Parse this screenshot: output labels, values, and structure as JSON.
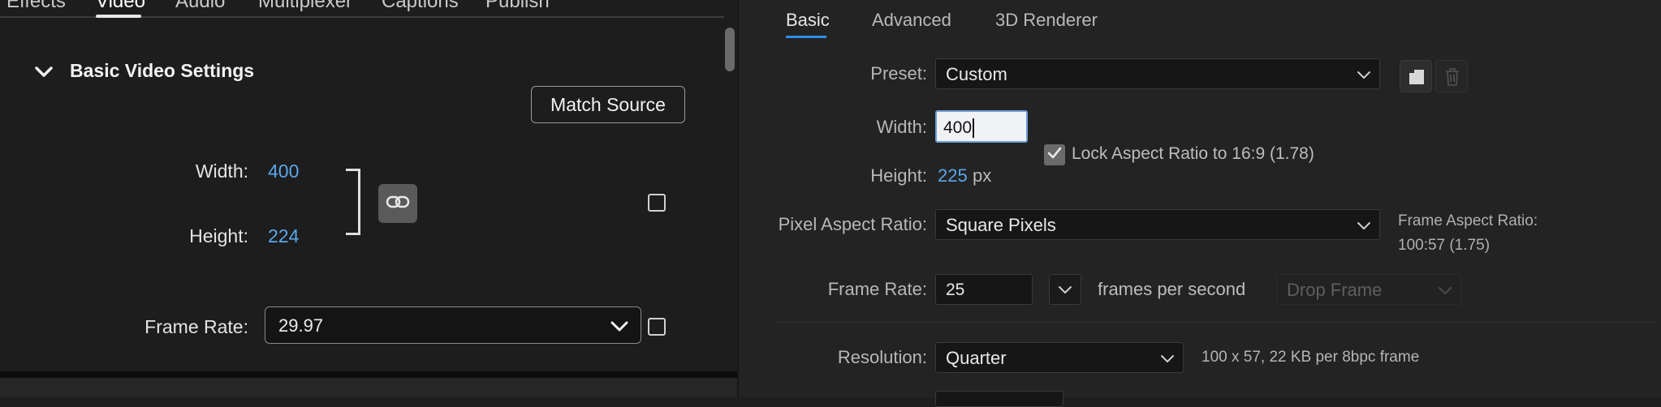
{
  "left_panel": {
    "tabs": [
      "Effects",
      "Video",
      "Audio",
      "Multiplexer",
      "Captions",
      "Publish"
    ],
    "active_tab": "Video",
    "section_title": "Basic Video Settings",
    "match_source_label": "Match Source",
    "width_label": "Width:",
    "width_value": "400",
    "height_label": "Height:",
    "height_value": "224",
    "frame_rate_label": "Frame Rate:",
    "frame_rate_value": "29.97",
    "accent_color": "#5aa7ea"
  },
  "right_panel": {
    "tabs": [
      "Basic",
      "Advanced",
      "3D Renderer"
    ],
    "active_tab": "Basic",
    "preset_label": "Preset:",
    "preset_value": "Custom",
    "width_label": "Width:",
    "width_value": "400",
    "lock_aspect_label": "Lock Aspect Ratio to 16:9 (1.78)",
    "lock_aspect_checked": true,
    "height_label": "Height:",
    "height_value": "225",
    "height_unit": "px",
    "pixel_aspect_label": "Pixel Aspect Ratio:",
    "pixel_aspect_value": "Square Pixels",
    "frame_aspect_label": "Frame Aspect Ratio:",
    "frame_aspect_value": "100:57 (1.75)",
    "frame_rate_label": "Frame Rate:",
    "frame_rate_value": "25",
    "frame_rate_unit": "frames per second",
    "drop_frame_value": "Drop Frame",
    "resolution_label": "Resolution:",
    "resolution_value": "Quarter",
    "resolution_info": "100 x 57, 22 KB per 8bpc frame",
    "tab_accent_color": "#2d8ceb"
  }
}
